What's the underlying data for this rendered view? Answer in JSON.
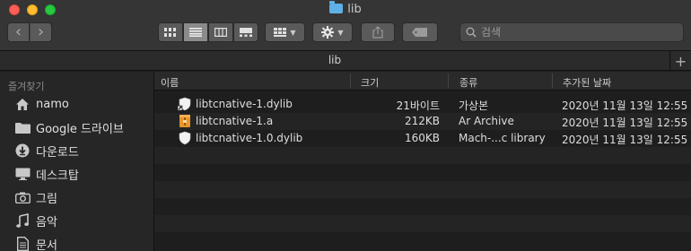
{
  "window": {
    "title": "lib"
  },
  "toolbar": {
    "back_glyph": "‹",
    "forward_glyph": "›",
    "search_placeholder": "검색"
  },
  "tabbar": {
    "label": "lib",
    "add_glyph": "+"
  },
  "sidebar": {
    "heading": "즐겨찾기",
    "items": [
      {
        "label": "namo",
        "icon": "home-icon"
      },
      {
        "label": "Google 드라이브",
        "icon": "folder-icon"
      },
      {
        "label": "다운로드",
        "icon": "download-icon"
      },
      {
        "label": "데스크탑",
        "icon": "desktop-icon"
      },
      {
        "label": "그림",
        "icon": "camera-icon"
      },
      {
        "label": "음악",
        "icon": "music-icon"
      },
      {
        "label": "문서",
        "icon": "document-icon"
      }
    ]
  },
  "list": {
    "columns": {
      "name": "이름",
      "size": "크기",
      "kind": "종류",
      "date": "추가된 날짜"
    },
    "rows": [
      {
        "name": "libtcnative-1.dylib",
        "size": "21바이트",
        "kind": "가상본",
        "date": "2020년 11월 13일 12:55",
        "icon": "alias-shield-icon"
      },
      {
        "name": "libtcnative-1.a",
        "size": "212KB",
        "kind": "Ar Archive",
        "date": "2020년 11월 13일 12:55",
        "icon": "archive-icon"
      },
      {
        "name": "libtcnative-1.0.dylib",
        "size": "160KB",
        "kind": "Mach-...c library",
        "date": "2020년 11월 13일 12:55",
        "icon": "shield-icon"
      }
    ]
  },
  "colors": {
    "accent_folder": "#5fb0e6",
    "archive_orange": "#e8962c"
  }
}
